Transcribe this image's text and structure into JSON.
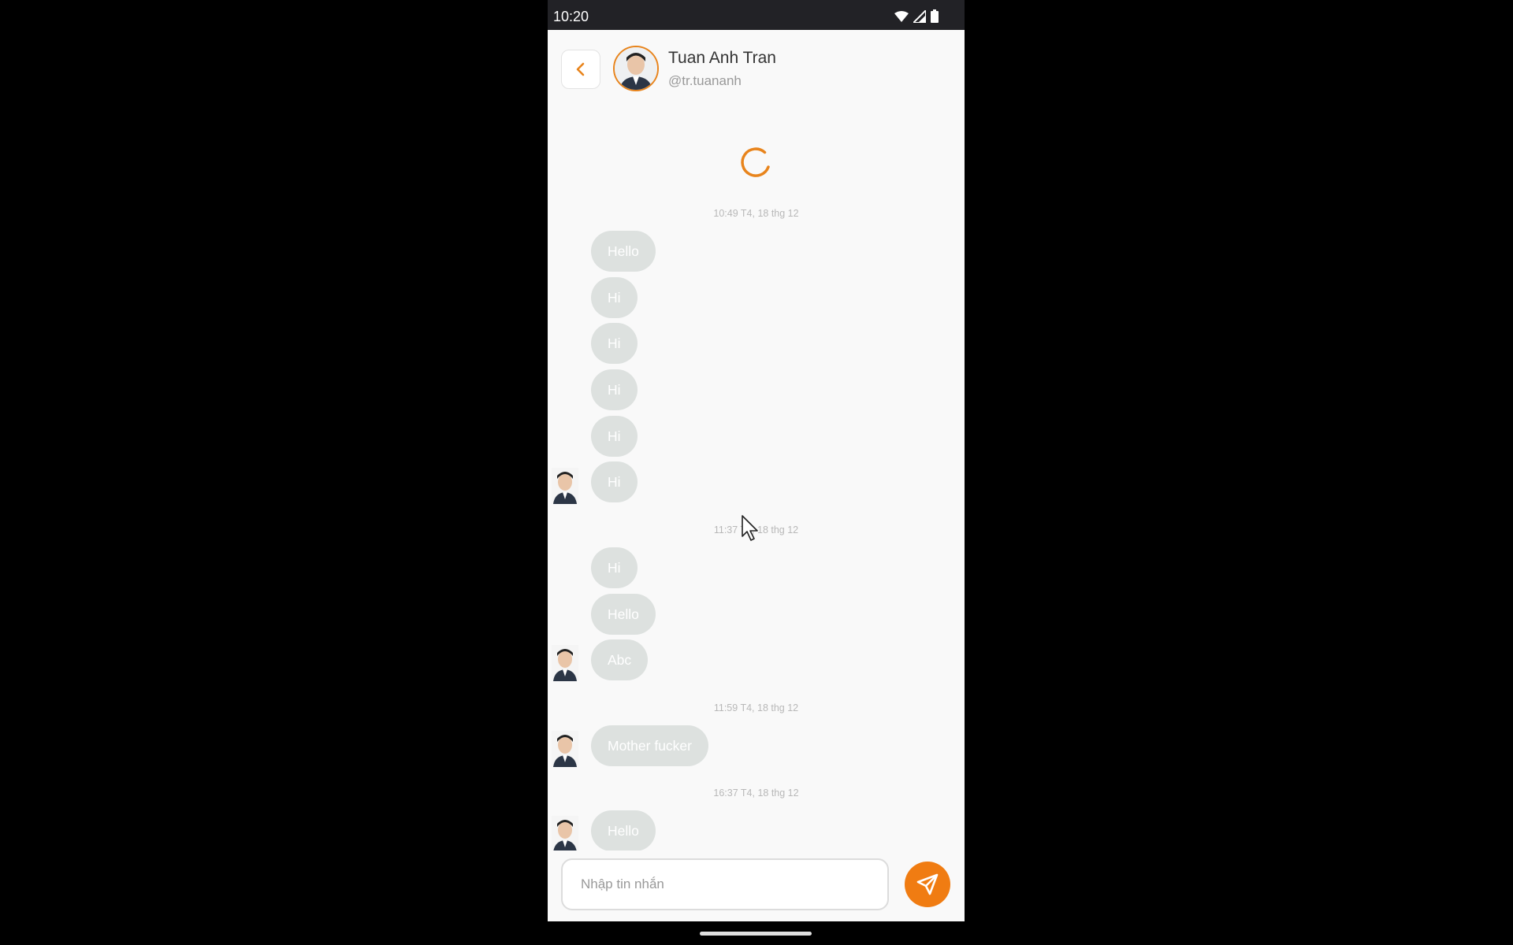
{
  "status_bar": {
    "time": "10:20"
  },
  "header": {
    "name": "Tuan Anh Tran",
    "handle": "@tr.tuananh"
  },
  "messages": {
    "g1": {
      "timestamp": "10:49 T4, 18 thg 12",
      "m0": "Hello",
      "m1": "Hi",
      "m2": "Hi",
      "m3": "Hi",
      "m4": "Hi",
      "m5": "Hi"
    },
    "g2": {
      "timestamp": "11:37 T4, 18 thg 12",
      "m0": "Hi",
      "m1": "Hello",
      "m2": "Abc"
    },
    "g3": {
      "timestamp": "11:59 T4, 18 thg 12",
      "m0": "Mother fucker"
    },
    "g4": {
      "timestamp": "16:37 T4, 18 thg 12",
      "m0": "Hello"
    }
  },
  "composer": {
    "placeholder": "Nhập tin nhắn"
  },
  "colors": {
    "accent": "#f07c12",
    "bubble": "#dde1df",
    "background": "#f9f9f9"
  },
  "icons": {
    "back": "chevron-left-icon",
    "send": "send-icon",
    "loading": "loading-spinner"
  }
}
